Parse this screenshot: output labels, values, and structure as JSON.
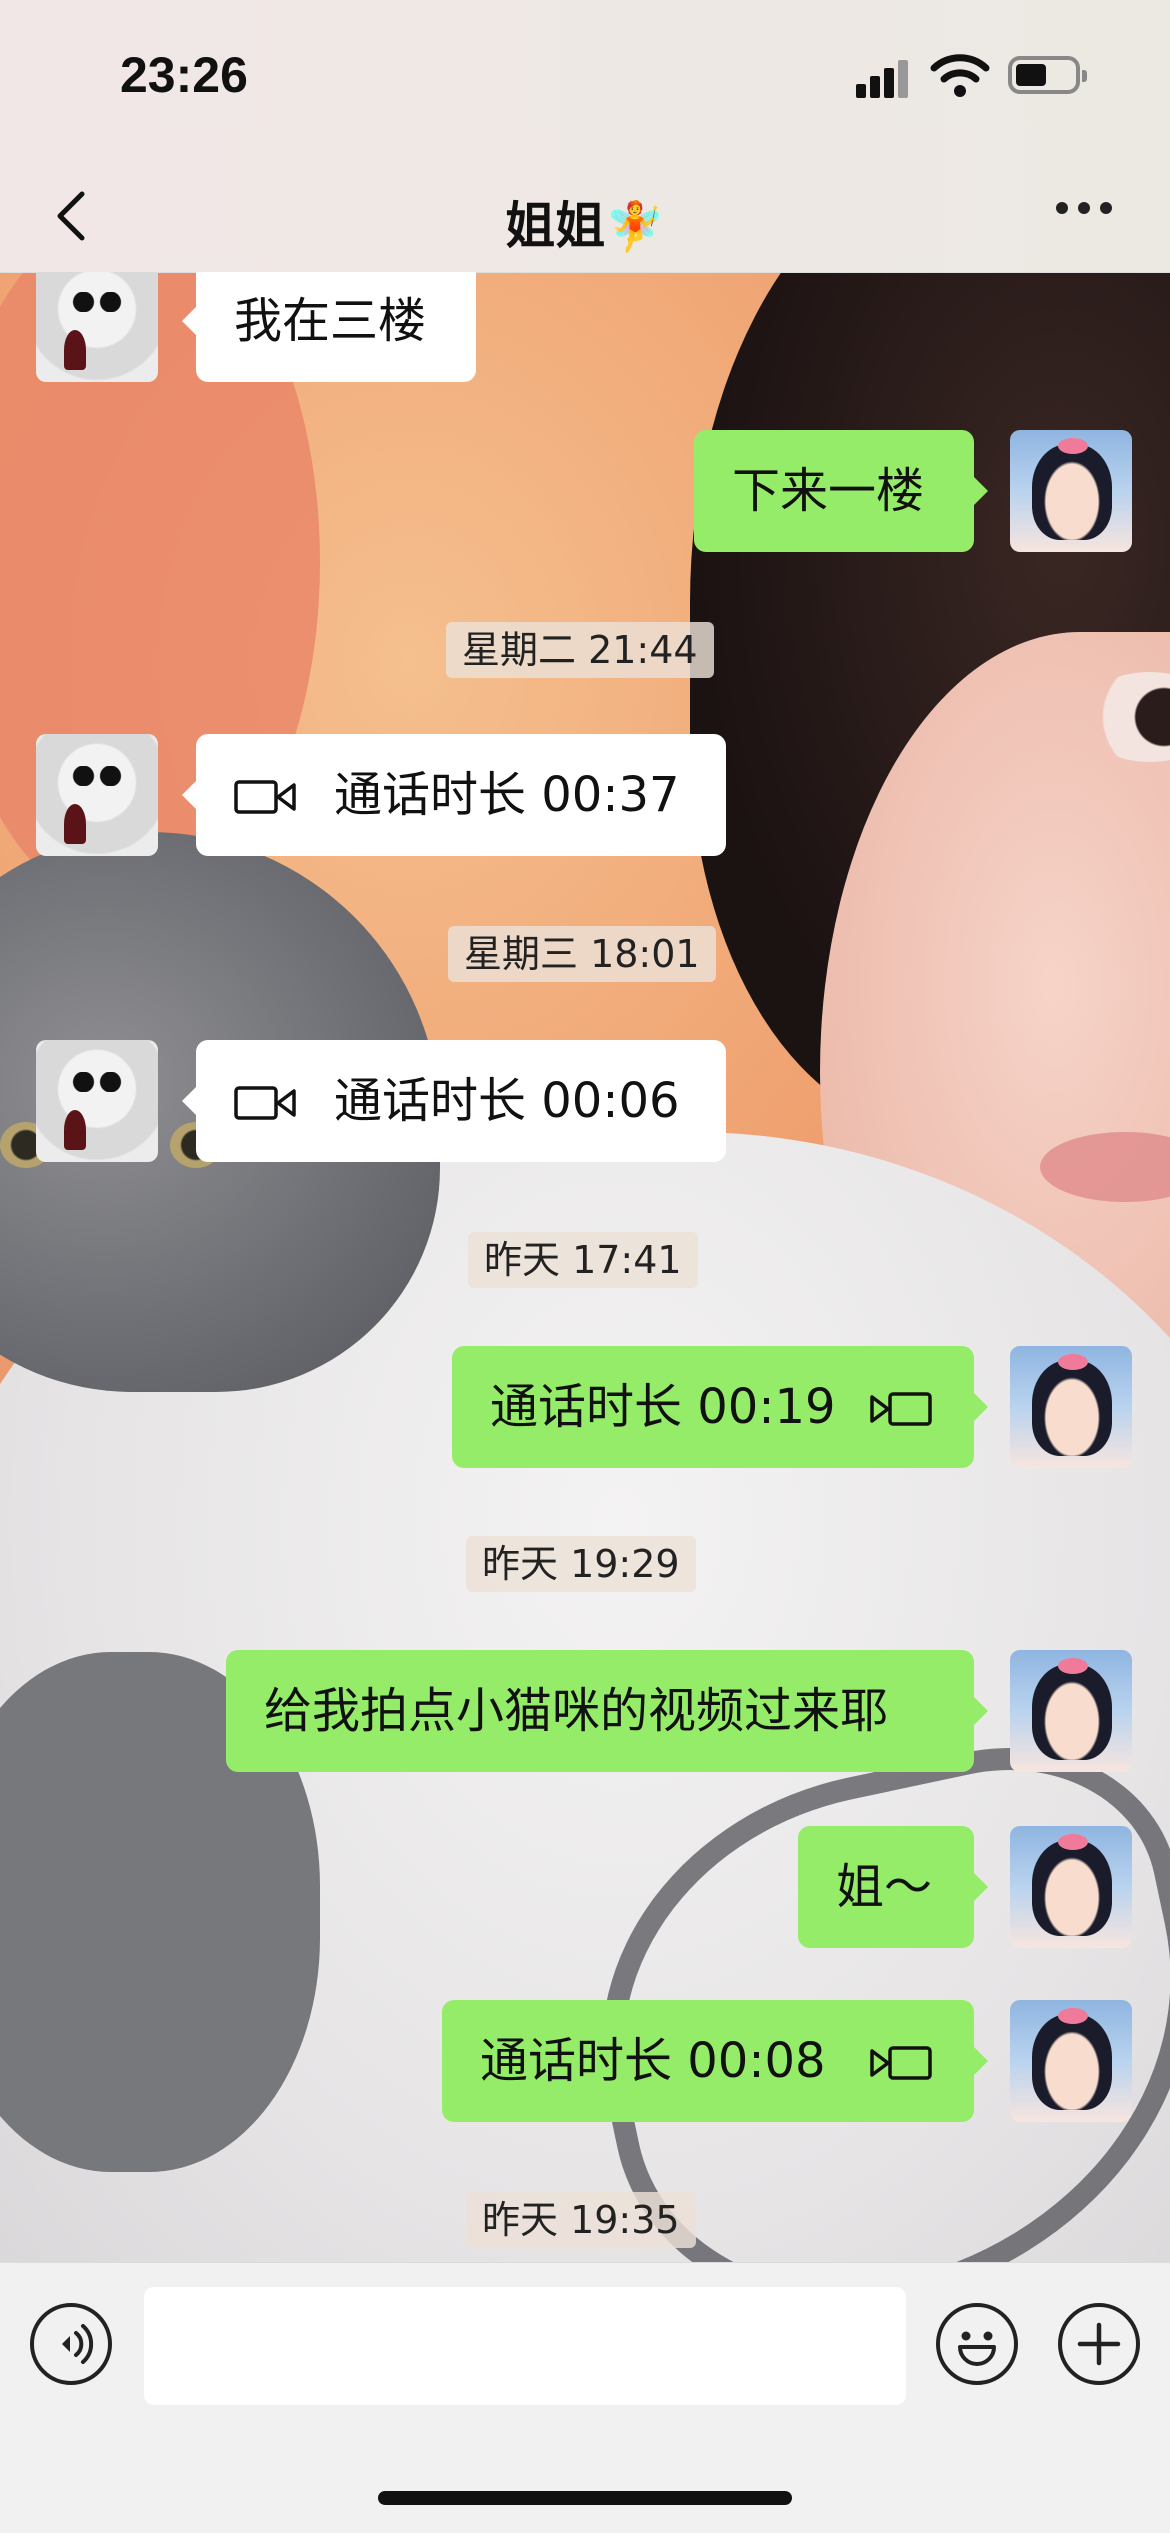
{
  "status_bar": {
    "time": "23:26",
    "signal_icon": "signal-bars-icon",
    "wifi_icon": "wifi-icon",
    "battery_icon": "battery-icon"
  },
  "header": {
    "title": "姐姐",
    "title_emoji": "🧚",
    "back_icon": "chevron-left-icon",
    "more_icon": "ellipsis-icon"
  },
  "messages": [
    {
      "side": "in",
      "type": "text",
      "text": "我在三楼"
    },
    {
      "side": "out",
      "type": "text",
      "text": "下来一楼"
    },
    {
      "type": "timestamp",
      "text": "星期二 21:44"
    },
    {
      "side": "in",
      "type": "video-call",
      "text": "通话时长 00:37",
      "icon": "video-camera-icon"
    },
    {
      "type": "timestamp",
      "text": "星期三 18:01"
    },
    {
      "side": "in",
      "type": "video-call",
      "text": "通话时长 00:06",
      "icon": "video-camera-icon"
    },
    {
      "type": "timestamp",
      "text": "昨天 17:41"
    },
    {
      "side": "out",
      "type": "video-call",
      "text": "通话时长 00:19",
      "icon": "video-camera-icon"
    },
    {
      "type": "timestamp",
      "text": "昨天 19:29"
    },
    {
      "side": "out",
      "type": "text",
      "text": "给我拍点小猫咪的视频过来耶"
    },
    {
      "side": "out",
      "type": "text",
      "text": "姐～"
    },
    {
      "side": "out",
      "type": "video-call",
      "text": "通话时长 00:08",
      "icon": "video-camera-icon"
    },
    {
      "type": "timestamp",
      "text": "昨天 19:35"
    }
  ],
  "input_bar": {
    "voice_icon": "voice-icon",
    "message_value": "",
    "emoji_icon": "emoji-icon",
    "plus_icon": "plus-icon"
  },
  "colors": {
    "outgoing_bubble": "#95ec69",
    "incoming_bubble": "#ffffff",
    "header_bg": "#ece9e3",
    "input_bar_bg": "#f2f1f1"
  }
}
